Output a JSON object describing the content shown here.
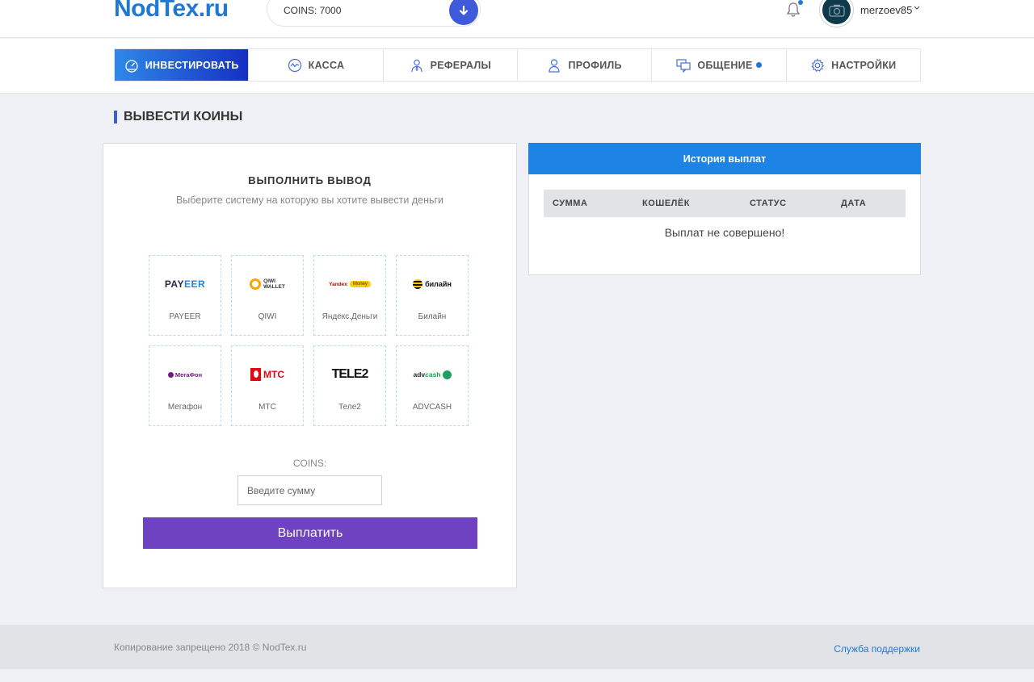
{
  "header": {
    "logo": "NodTex.ru",
    "coins_text": "COINS: 7000",
    "username": "merzoev85"
  },
  "nav": {
    "items": [
      {
        "label": "ИНВЕСТИРОВАТЬ",
        "icon": "speedometer-icon",
        "active": true
      },
      {
        "label": "КАССА",
        "icon": "chart-wave-icon"
      },
      {
        "label": "РЕФЕРАЛЫ",
        "icon": "user-tie-icon"
      },
      {
        "label": "ПРОФИЛЬ",
        "icon": "user-icon"
      },
      {
        "label": "ОБЩЕНИЕ",
        "icon": "chat-icon",
        "badge": true
      },
      {
        "label": "НАСТРОЙКИ",
        "icon": "gear-icon"
      }
    ]
  },
  "page": {
    "title": "ВЫВЕСТИ КОИНЫ"
  },
  "withdraw": {
    "title": "ВЫПОЛНИТЬ ВЫВОД",
    "subtitle": "Выберите систему на которую вы хотите вывести деньги",
    "systems": [
      {
        "label": "PAYEER",
        "logo_text": "PAYEER"
      },
      {
        "label": "QIWI",
        "logo_text": "QIWI WALLET"
      },
      {
        "label": "Яндекс.Деньги",
        "logo_text": "Yandex Money"
      },
      {
        "label": "Билайн",
        "logo_text": "билайн"
      },
      {
        "label": "Мегафон",
        "logo_text": "МегаФон"
      },
      {
        "label": "МТС",
        "logo_text": "МТС"
      },
      {
        "label": "Теле2",
        "logo_text": "TELE2"
      },
      {
        "label": "ADVCASH",
        "logo_text": "advcash"
      }
    ],
    "coins_label": "COINS:",
    "amount_placeholder": "Введите сумму",
    "submit_label": "Выплатить"
  },
  "history": {
    "title": "История выплат",
    "columns": [
      "СУММА",
      "КОШЕЛЁК",
      "СТАТУС",
      "ДАТА"
    ],
    "empty_text": "Выплат не совершено!"
  },
  "footer": {
    "copyright": "Копирование запрещено 2018 © NodTex.ru",
    "support": "Служба поддержки"
  },
  "colors": {
    "brand": "#1f78d6",
    "accent": "#3e59d9",
    "submit": "#6f42c1",
    "history_header": "#1d84e6"
  }
}
